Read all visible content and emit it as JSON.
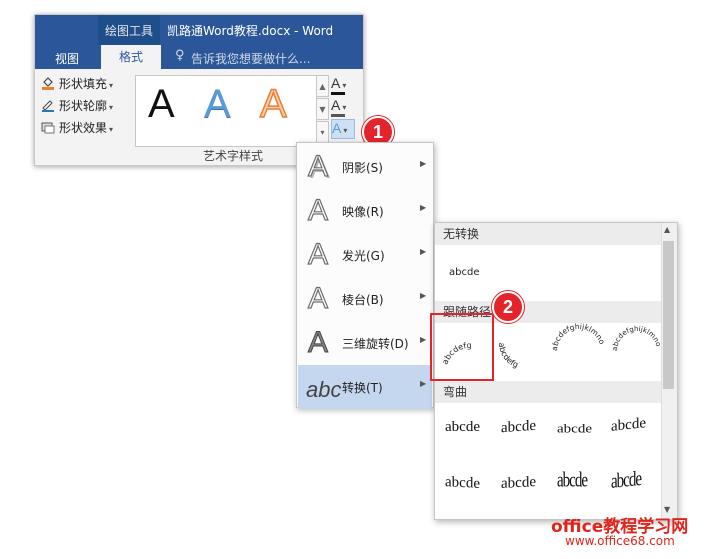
{
  "ribbon": {
    "contextual_label": "绘图工具",
    "doc_title": "凯路通Word教程.docx - Word",
    "tabs": [
      {
        "label": "视图"
      },
      {
        "label": "格式"
      }
    ],
    "tell_me": "告诉我您想要做什么...",
    "shape_commands": [
      {
        "label": "形状填充",
        "icon": "paint-bucket-icon"
      },
      {
        "label": "形状轮廓",
        "icon": "pen-outline-icon"
      },
      {
        "label": "形状效果",
        "icon": "shape-effects-icon"
      }
    ],
    "gallery": {
      "glyph": "A",
      "styles": [
        "black",
        "blue-gradient",
        "orange-outline"
      ]
    },
    "text_format_buttons": [
      {
        "glyph": "A",
        "name": "text-fill",
        "color": "#111111"
      },
      {
        "glyph": "A",
        "name": "text-outline",
        "color": "#555555"
      },
      {
        "glyph": "A",
        "name": "text-effects",
        "color": "#5b9bd5"
      }
    ],
    "group_label": "艺术字样式"
  },
  "effects_menu": {
    "items": [
      {
        "label": "阴影(S)",
        "icon": "shadow-a-icon"
      },
      {
        "label": "映像(R)",
        "icon": "reflection-a-icon"
      },
      {
        "label": "发光(G)",
        "icon": "glow-a-icon"
      },
      {
        "label": "棱台(B)",
        "icon": "bevel-a-icon"
      },
      {
        "label": "三维旋转(D)",
        "icon": "3d-rotation-a-icon"
      },
      {
        "label": "转换(T)",
        "icon": "transform-abc-icon",
        "selected": true
      }
    ]
  },
  "transform_panel": {
    "no_transform_header": "无转换",
    "no_transform_sample": "abcde",
    "follow_path_header": "跟随路径",
    "follow_path_samples": [
      "abcdefg",
      "abcdefg",
      "abcdefghijklmno",
      "abcdefghijklmno"
    ],
    "warp_header": "弯曲",
    "warp_samples": [
      "abcde",
      "abcde",
      "abcde",
      "abcde",
      "abcde",
      "abcde",
      "abcde",
      "abcde"
    ]
  },
  "callouts": [
    "1",
    "2"
  ],
  "watermark": {
    "line1": "office教程学习网",
    "line2": "www.office68.com"
  },
  "colors": {
    "ribbon_blue": "#2b579a",
    "callout_red": "#e3242b",
    "menu_highlight": "#c5d6ef"
  }
}
